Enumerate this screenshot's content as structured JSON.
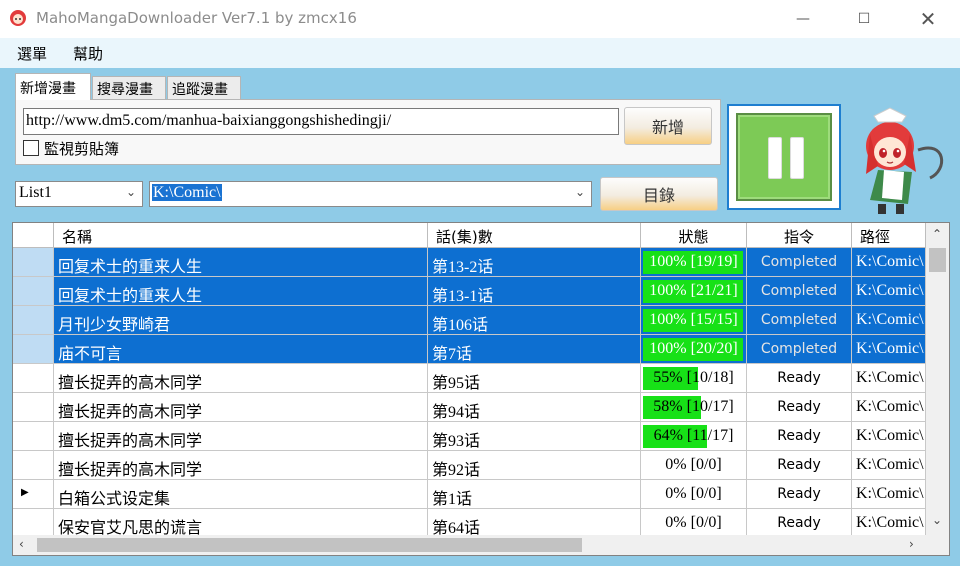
{
  "window": {
    "title": "MahoMangaDownloader Ver7.1 by zmcx16"
  },
  "menu": {
    "items": [
      "選單",
      "幫助"
    ]
  },
  "tabs": [
    "新增漫畫",
    "搜尋漫畫",
    "追蹤漫畫"
  ],
  "add_panel": {
    "url_value": "http://www.dm5.com/manhua-baixianggongshishedingji/",
    "add_button": "新增",
    "clipboard_label": "監視剪貼簿",
    "clipboard_checked": false
  },
  "controls": {
    "list_value": "List1",
    "dir_value": "K:\\Comic\\",
    "dir_button": "目錄",
    "pause_state": "paused"
  },
  "table": {
    "columns": [
      "名稱",
      "話(集)數",
      "狀態",
      "指令",
      "路徑"
    ],
    "rows": [
      {
        "name": "回复术士的重来人生",
        "ep": "第13-2话",
        "status": "100% [19/19]",
        "progress": 100,
        "cmd": "Completed",
        "path": "K:\\Comic\\",
        "selected": true
      },
      {
        "name": "回复术士的重来人生",
        "ep": "第13-1话",
        "status": "100% [21/21]",
        "progress": 100,
        "cmd": "Completed",
        "path": "K:\\Comic\\",
        "selected": true
      },
      {
        "name": "月刊少女野崎君",
        "ep": "第106话",
        "status": "100% [15/15]",
        "progress": 100,
        "cmd": "Completed",
        "path": "K:\\Comic\\",
        "selected": true
      },
      {
        "name": "庙不可言",
        "ep": "第7话",
        "status": "100% [20/20]",
        "progress": 100,
        "cmd": "Completed",
        "path": "K:\\Comic\\",
        "selected": true
      },
      {
        "name": "擅长捉弄的高木同学",
        "ep": "第95话",
        "status": "55% [10/18]",
        "progress": 55,
        "cmd": "Ready",
        "path": "K:\\Comic\\",
        "selected": false
      },
      {
        "name": "擅长捉弄的高木同学",
        "ep": "第94话",
        "status": "58% [10/17]",
        "progress": 58,
        "cmd": "Ready",
        "path": "K:\\Comic\\",
        "selected": false
      },
      {
        "name": "擅长捉弄的高木同学",
        "ep": "第93话",
        "status": "64% [11/17]",
        "progress": 64,
        "cmd": "Ready",
        "path": "K:\\Comic\\",
        "selected": false
      },
      {
        "name": "擅长捉弄的高木同学",
        "ep": "第92话",
        "status": "0% [0/0]",
        "progress": 0,
        "cmd": "Ready",
        "path": "K:\\Comic\\",
        "selected": false
      },
      {
        "name": "白箱公式设定集",
        "ep": "第1话",
        "status": "0% [0/0]",
        "progress": 0,
        "cmd": "Ready",
        "path": "K:\\Comic\\",
        "selected": false,
        "current": true
      },
      {
        "name": "保安官艾凡思的谎言",
        "ep": "第64话",
        "status": "0% [0/0]",
        "progress": 0,
        "cmd": "Ready",
        "path": "K:\\Comic\\",
        "selected": false
      }
    ]
  },
  "colors": {
    "background": "#8fcbe7",
    "selection": "#0d6fd1",
    "progress": "#17e117",
    "pause_button": "#7dca56"
  }
}
